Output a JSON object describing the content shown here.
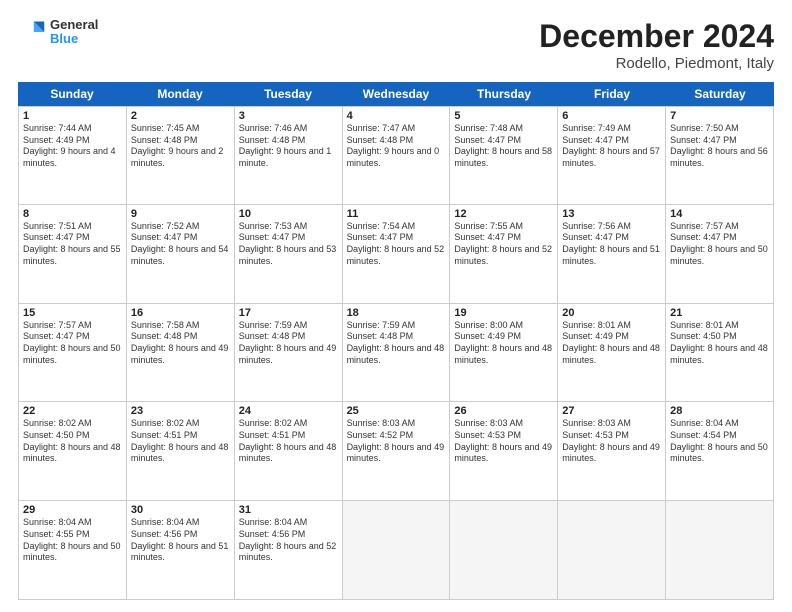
{
  "logo": {
    "line1": "General",
    "line2": "Blue"
  },
  "title": "December 2024",
  "subtitle": "Rodello, Piedmont, Italy",
  "days": [
    "Sunday",
    "Monday",
    "Tuesday",
    "Wednesday",
    "Thursday",
    "Friday",
    "Saturday"
  ],
  "weeks": [
    [
      {
        "day": "1",
        "sunrise": "7:44 AM",
        "sunset": "4:49 PM",
        "daylight": "9 hours and 4 minutes."
      },
      {
        "day": "2",
        "sunrise": "7:45 AM",
        "sunset": "4:48 PM",
        "daylight": "9 hours and 2 minutes."
      },
      {
        "day": "3",
        "sunrise": "7:46 AM",
        "sunset": "4:48 PM",
        "daylight": "9 hours and 1 minute."
      },
      {
        "day": "4",
        "sunrise": "7:47 AM",
        "sunset": "4:48 PM",
        "daylight": "9 hours and 0 minutes."
      },
      {
        "day": "5",
        "sunrise": "7:48 AM",
        "sunset": "4:47 PM",
        "daylight": "8 hours and 58 minutes."
      },
      {
        "day": "6",
        "sunrise": "7:49 AM",
        "sunset": "4:47 PM",
        "daylight": "8 hours and 57 minutes."
      },
      {
        "day": "7",
        "sunrise": "7:50 AM",
        "sunset": "4:47 PM",
        "daylight": "8 hours and 56 minutes."
      }
    ],
    [
      {
        "day": "8",
        "sunrise": "7:51 AM",
        "sunset": "4:47 PM",
        "daylight": "8 hours and 55 minutes."
      },
      {
        "day": "9",
        "sunrise": "7:52 AM",
        "sunset": "4:47 PM",
        "daylight": "8 hours and 54 minutes."
      },
      {
        "day": "10",
        "sunrise": "7:53 AM",
        "sunset": "4:47 PM",
        "daylight": "8 hours and 53 minutes."
      },
      {
        "day": "11",
        "sunrise": "7:54 AM",
        "sunset": "4:47 PM",
        "daylight": "8 hours and 52 minutes."
      },
      {
        "day": "12",
        "sunrise": "7:55 AM",
        "sunset": "4:47 PM",
        "daylight": "8 hours and 52 minutes."
      },
      {
        "day": "13",
        "sunrise": "7:56 AM",
        "sunset": "4:47 PM",
        "daylight": "8 hours and 51 minutes."
      },
      {
        "day": "14",
        "sunrise": "7:57 AM",
        "sunset": "4:47 PM",
        "daylight": "8 hours and 50 minutes."
      }
    ],
    [
      {
        "day": "15",
        "sunrise": "7:57 AM",
        "sunset": "4:47 PM",
        "daylight": "8 hours and 50 minutes."
      },
      {
        "day": "16",
        "sunrise": "7:58 AM",
        "sunset": "4:48 PM",
        "daylight": "8 hours and 49 minutes."
      },
      {
        "day": "17",
        "sunrise": "7:59 AM",
        "sunset": "4:48 PM",
        "daylight": "8 hours and 49 minutes."
      },
      {
        "day": "18",
        "sunrise": "7:59 AM",
        "sunset": "4:48 PM",
        "daylight": "8 hours and 48 minutes."
      },
      {
        "day": "19",
        "sunrise": "8:00 AM",
        "sunset": "4:49 PM",
        "daylight": "8 hours and 48 minutes."
      },
      {
        "day": "20",
        "sunrise": "8:01 AM",
        "sunset": "4:49 PM",
        "daylight": "8 hours and 48 minutes."
      },
      {
        "day": "21",
        "sunrise": "8:01 AM",
        "sunset": "4:50 PM",
        "daylight": "8 hours and 48 minutes."
      }
    ],
    [
      {
        "day": "22",
        "sunrise": "8:02 AM",
        "sunset": "4:50 PM",
        "daylight": "8 hours and 48 minutes."
      },
      {
        "day": "23",
        "sunrise": "8:02 AM",
        "sunset": "4:51 PM",
        "daylight": "8 hours and 48 minutes."
      },
      {
        "day": "24",
        "sunrise": "8:02 AM",
        "sunset": "4:51 PM",
        "daylight": "8 hours and 48 minutes."
      },
      {
        "day": "25",
        "sunrise": "8:03 AM",
        "sunset": "4:52 PM",
        "daylight": "8 hours and 49 minutes."
      },
      {
        "day": "26",
        "sunrise": "8:03 AM",
        "sunset": "4:53 PM",
        "daylight": "8 hours and 49 minutes."
      },
      {
        "day": "27",
        "sunrise": "8:03 AM",
        "sunset": "4:53 PM",
        "daylight": "8 hours and 49 minutes."
      },
      {
        "day": "28",
        "sunrise": "8:04 AM",
        "sunset": "4:54 PM",
        "daylight": "8 hours and 50 minutes."
      }
    ],
    [
      {
        "day": "29",
        "sunrise": "8:04 AM",
        "sunset": "4:55 PM",
        "daylight": "8 hours and 50 minutes."
      },
      {
        "day": "30",
        "sunrise": "8:04 AM",
        "sunset": "4:56 PM",
        "daylight": "8 hours and 51 minutes."
      },
      {
        "day": "31",
        "sunrise": "8:04 AM",
        "sunset": "4:56 PM",
        "daylight": "8 hours and 52 minutes."
      },
      null,
      null,
      null,
      null
    ]
  ]
}
